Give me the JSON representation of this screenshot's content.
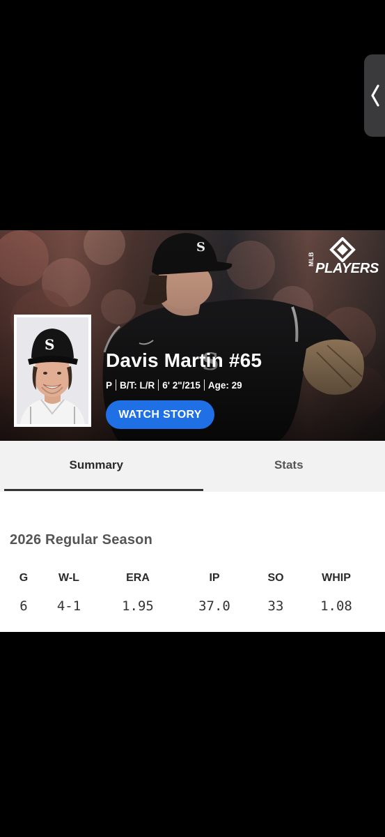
{
  "player": {
    "name": "Davis Martin #65",
    "position": "P",
    "bats_throws": "B/T: L/R",
    "height_weight": "6' 2\"/215",
    "age": "Age: 29"
  },
  "brand": {
    "mlb": "MLB",
    "players": "PLAYERS"
  },
  "actions": {
    "watch_story": "WATCH STORY"
  },
  "tabs": [
    {
      "label": "Summary",
      "active": true
    },
    {
      "label": "Stats",
      "active": false
    }
  ],
  "season": {
    "title": "2026 Regular Season",
    "headers": [
      "G",
      "W-L",
      "ERA",
      "IP",
      "SO",
      "WHIP"
    ],
    "values": [
      "6",
      "4-1",
      "1.95",
      "37.0",
      "33",
      "1.08"
    ]
  },
  "colors": {
    "accent": "#1f6fe5",
    "background": "#000000",
    "tab_bar": "#f2f2f2"
  }
}
